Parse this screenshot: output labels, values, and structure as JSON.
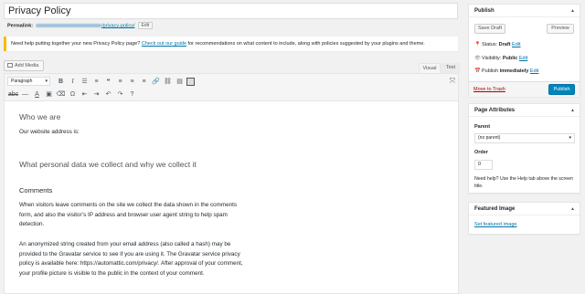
{
  "post_title": "Privacy Policy",
  "permalink": {
    "label": "Permalink:",
    "slug": "/privacy-policy/",
    "edit_label": "Edit"
  },
  "notice": {
    "text_before": "Need help putting together your new Privacy Policy page? ",
    "link_text": "Check out our guide",
    "text_after": " for recommendations on what content to include, along with policies suggested by your plugins and theme.",
    "accent_color": "#ffb900"
  },
  "editor": {
    "add_media_label": "Add Media",
    "tabs": [
      "Visual",
      "Text"
    ],
    "format_select": "Paragraph",
    "toolbar_row1_icons": [
      "bold-icon",
      "italic-icon",
      "bullet-list-icon",
      "numbered-list-icon",
      "blockquote-icon",
      "align-left-icon",
      "align-center-icon",
      "align-right-icon",
      "link-icon",
      "unlink-icon",
      "read-more-icon",
      "toolbar-toggle-icon"
    ],
    "toolbar_row2_icons": [
      "strikethrough-icon",
      "horizontal-line-icon",
      "text-color-icon",
      "paste-text-icon",
      "clear-formatting-icon",
      "special-character-icon",
      "outdent-icon",
      "indent-icon",
      "undo-icon",
      "redo-icon",
      "help-icon"
    ],
    "content": {
      "h_who": "Who we are",
      "p_address": "Our website address is:",
      "h_personal": "What personal data we collect and why we collect it",
      "h_comments": "Comments",
      "p_comments1": "When visitors leave comments on the site we collect the data shown in the comments form, and also the visitor’s IP address and browser user agent string to help spam detection.",
      "p_comments2": "An anonymized string created from your email address (also called a hash) may be provided to the Gravatar service to see if you are using it. The Gravatar service privacy policy is available here: https://automattic.com/privacy/. After approval of your comment, your profile picture is visible to the public in the context of your comment."
    }
  },
  "publish_box": {
    "title": "Publish",
    "save_draft": "Save Draft",
    "preview": "Preview",
    "status_label": "Status:",
    "status_value": "Draft",
    "visibility_label": "Visibility:",
    "visibility_value": "Public",
    "publish_label": "Publish",
    "publish_value": "immediately",
    "edit_label": "Edit",
    "trash": "Move to Trash",
    "publish_button": "Publish",
    "primary_color": "#0085ba",
    "trash_color": "#a00"
  },
  "page_attributes": {
    "title": "Page Attributes",
    "parent_label": "Parent",
    "parent_value": "(no parent)",
    "order_label": "Order",
    "order_value": "0",
    "help": "Need help? Use the Help tab above the screen title."
  },
  "featured_image": {
    "title": "Featured Image",
    "link": "Set featured image"
  }
}
